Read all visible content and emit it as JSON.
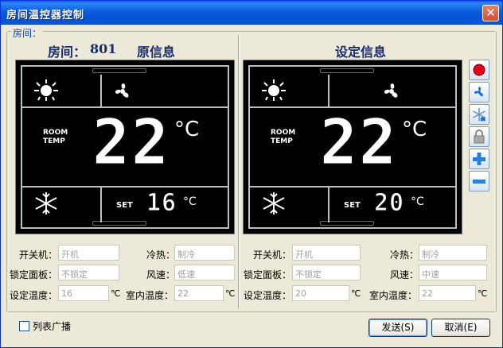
{
  "window": {
    "title": "房间温控器控制",
    "close_glyph": "✕"
  },
  "group": {
    "label": "房间："
  },
  "left": {
    "room_label": "房间：",
    "room_number": "801",
    "heading": "原信息",
    "lcd": {
      "room_temp_line1": "ROOM",
      "room_temp_line2": "TEMP",
      "big_temp": "22",
      "unit": "°C",
      "set_label": "SET",
      "set_temp": "16",
      "set_unit": "°C"
    },
    "fields": {
      "power_label": "开关机：",
      "power_value": "开机",
      "mode_label": "冷热：",
      "mode_value": "制冷",
      "lock_label": "锁定面板：",
      "lock_value": "不锁定",
      "fan_label": "风速：",
      "fan_value": "低速",
      "set_temp_label": "设定温度：",
      "set_temp_value": "16",
      "set_temp_unit": "℃",
      "room_temp_label": "室内温度：",
      "room_temp_value": "22",
      "room_temp_unit": "℃"
    }
  },
  "right": {
    "heading": "设定信息",
    "lcd": {
      "room_temp_line1": "ROOM",
      "room_temp_line2": "TEMP",
      "big_temp": "22",
      "unit": "°C",
      "set_label": "SET",
      "set_temp": "20",
      "set_unit": "°C"
    },
    "fields": {
      "power_label": "开关机：",
      "power_value": "开机",
      "mode_label": "冷热：",
      "mode_value": "制冷",
      "lock_label": "锁定面板：",
      "lock_value": "不锁定",
      "fan_label": "风速：",
      "fan_value": "中速",
      "set_temp_label": "设定温度：",
      "set_temp_value": "20",
      "set_temp_unit": "℃",
      "room_temp_label": "室内温度：",
      "room_temp_value": "22",
      "room_temp_unit": "℃"
    }
  },
  "side_buttons": [
    "power-icon",
    "fan-icon",
    "snowflake-icon",
    "lock-icon",
    "plus-icon",
    "minus-icon"
  ],
  "footer": {
    "broadcast_label": "列表广播",
    "broadcast_checked": false,
    "send_label": "发送(S)",
    "cancel_label": "取消(E)"
  },
  "colors": {
    "title_bar": "#0a5cde",
    "heading": "#1a2c6b",
    "lcd_background": "#000000",
    "power_button": "#e0001c"
  }
}
